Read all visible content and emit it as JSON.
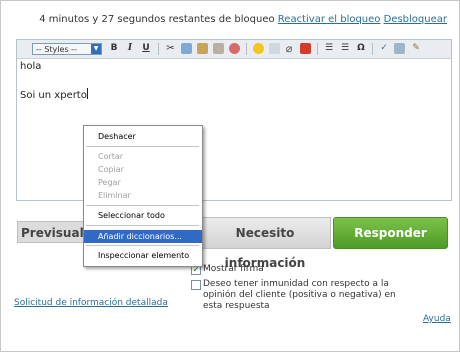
{
  "header": {
    "lock_text": "4 minutos y 27 segundos restantes de bloqueo",
    "reactivate_link": "Reactivar el bloqueo",
    "unlock_link": "Desbloquear"
  },
  "toolbar": {
    "styles_value": "-- Styles --",
    "bold": "B",
    "italic": "I",
    "underline": "U",
    "special_char": "Ω"
  },
  "editor": {
    "lines": [
      "hola",
      "",
      "Soi un xperto"
    ]
  },
  "buttons": {
    "preview": "Previsuali",
    "need_info": "Necesito información",
    "reply": "Responder"
  },
  "options": {
    "show_signature": "Mostrar firma",
    "immunity": "Deseo tener inmunidad con respecto a la opinión del cliente (positiva o negativa) en esta respuesta"
  },
  "links": {
    "detailed_info": "Solicitud de información detallada",
    "help": "Ayuda"
  },
  "context_menu": {
    "undo": "Deshacer",
    "cut": "Cortar",
    "copy": "Copiar",
    "paste": "Pegar",
    "delete": "Eliminar",
    "select_all": "Seleccionar todo",
    "add_dictionaries": "Añadir diccionarios...",
    "inspect": "Inspeccionar elemento"
  },
  "colors": {
    "link": "#2a6f98",
    "reply_button": "#5aa82e",
    "menu_highlight": "#316ac5"
  }
}
